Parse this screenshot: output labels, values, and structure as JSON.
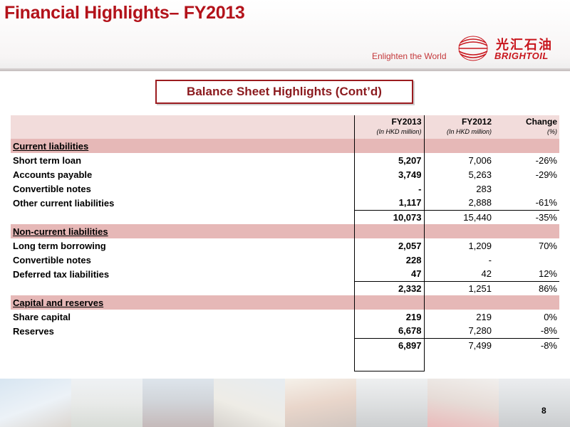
{
  "header": {
    "title": "Financial Highlights– FY2013",
    "tagline": "Enlighten the World"
  },
  "logo": {
    "chinese": "光汇石油",
    "english": "BRIGHTOIL",
    "icon": "brightoil-logo-icon",
    "brand_color": "#c8161d"
  },
  "section_title": "Balance Sheet Highlights (Cont’d)",
  "table": {
    "columns": [
      {
        "label": "FY2013",
        "sub": "(In HKD million)"
      },
      {
        "label": "FY2012",
        "sub": "(In HKD million)"
      },
      {
        "label": "Change",
        "sub": "(%)"
      }
    ],
    "sections": [
      {
        "title": "Current liabilities",
        "rows": [
          {
            "label": "Short term loan",
            "fy2013": "5,207",
            "fy2012": "7,006",
            "change": "-26%"
          },
          {
            "label": "Accounts payable",
            "fy2013": "3,749",
            "fy2012": "5,263",
            "change": "-29%"
          },
          {
            "label": "Convertible notes",
            "fy2013": "-",
            "fy2012": "283",
            "change": ""
          },
          {
            "label": "Other current liabilities",
            "fy2013": "1,117",
            "fy2012": "2,888",
            "change": "-61%"
          }
        ],
        "total": {
          "fy2013": "10,073",
          "fy2012": "15,440",
          "change": "-35%"
        }
      },
      {
        "title": "Non-current liabilities",
        "rows": [
          {
            "label": "Long term borrowing",
            "fy2013": "2,057",
            "fy2012": "1,209",
            "change": "70%"
          },
          {
            "label": "Convertible notes",
            "fy2013": "228",
            "fy2012": "-",
            "change": ""
          },
          {
            "label": "Deferred tax liabilities",
            "fy2013": "47",
            "fy2012": "42",
            "change": "12%"
          }
        ],
        "total": {
          "fy2013": "2,332",
          "fy2012": "1,251",
          "change": "86%"
        }
      },
      {
        "title": "Capital and reserves",
        "rows": [
          {
            "label": "Share capital",
            "fy2013": "219",
            "fy2012": "219",
            "change": "0%"
          },
          {
            "label": "Reserves",
            "fy2013": "6,678",
            "fy2012": "7,280",
            "change": "-8%"
          }
        ],
        "total": {
          "fy2013": "6,897",
          "fy2012": "7,499",
          "change": "-8%"
        }
      }
    ]
  },
  "colors": {
    "title_red": "#b3121a",
    "header_row": "#f2dcdb",
    "section_row": "#e6b8b7",
    "box_border": "#9b1b1f"
  },
  "footer": {
    "page_number": "8"
  }
}
